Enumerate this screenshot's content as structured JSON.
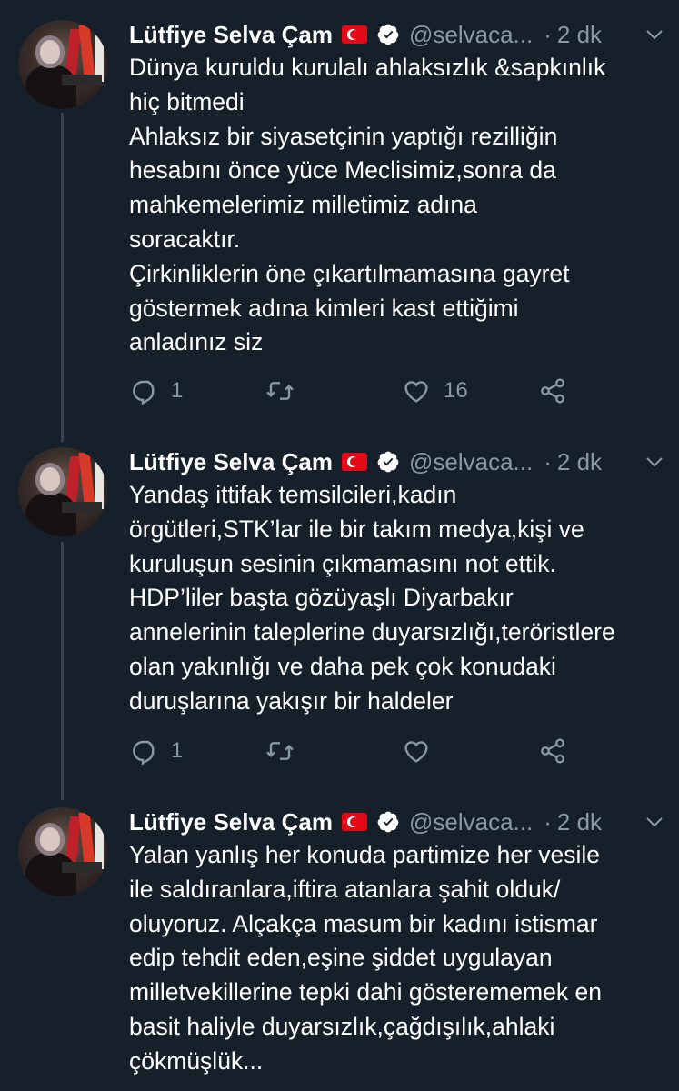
{
  "tweets": [
    {
      "author": {
        "name": "Lütfiye Selva Çam",
        "handle": "@selvaca...",
        "separator": "·",
        "time": "2 dk"
      },
      "text": "Dünya kuruldu kurulalı ahlaksızlık &sapkınlık\nhiç bitmedi\nAhlaksız bir siyasetçinin yaptığı rezilliğin\nhesabını önce yüce Meclisimiz,sonra da\nmahkemelerimiz milletimiz adına\nsoracaktır.\nÇirkinliklerin öne çıkartılmamasına gayret\ngöstermek adına kimleri kast ettiğimi\nanladınız siz",
      "counts": {
        "replies": "1",
        "retweets": "",
        "likes": "16"
      }
    },
    {
      "author": {
        "name": "Lütfiye Selva Çam",
        "handle": "@selvaca...",
        "separator": "·",
        "time": "2 dk"
      },
      "text": "Yandaş ittifak temsilcileri,kadın\nörgütleri,STK’lar ile bir takım medya,kişi ve\nkuruluşun sesinin çıkmamasını not ettik.\nHDP’liler başta gözüyaşlı Diyarbakır\nannelerinin taleplerine duyarsızlığı,teröristlere\nolan yakınlığı ve daha pek çok konudaki\nduruşlarına yakışır bir haldeler",
      "counts": {
        "replies": "1",
        "retweets": "",
        "likes": ""
      }
    },
    {
      "author": {
        "name": "Lütfiye Selva Çam",
        "handle": "@selvaca...",
        "separator": "·",
        "time": "2 dk"
      },
      "text": "Yalan yanlış her konuda partimize her vesile\nile saldıranlara,iftira atanlara şahit olduk/\noluyoruz. Alçakça masum bir kadını istismar\nedip tehdit eden,eşine şiddet uygulayan\nmilletvekillerine tepki dahi gösterememek en\nbasit haliyle duyarsızlık,çağdışılık,ahlaki\nçökmüşlük..."
    }
  ],
  "icons": [
    "turkey-flag-icon",
    "verified-badge-icon",
    "chevron-down-icon",
    "reply-icon",
    "retweet-icon",
    "like-icon",
    "share-icon"
  ],
  "colors": {
    "background": "#15202b",
    "secondary_text": "#8899a6",
    "thread_line": "#38444d",
    "verified": "#ffffff"
  }
}
